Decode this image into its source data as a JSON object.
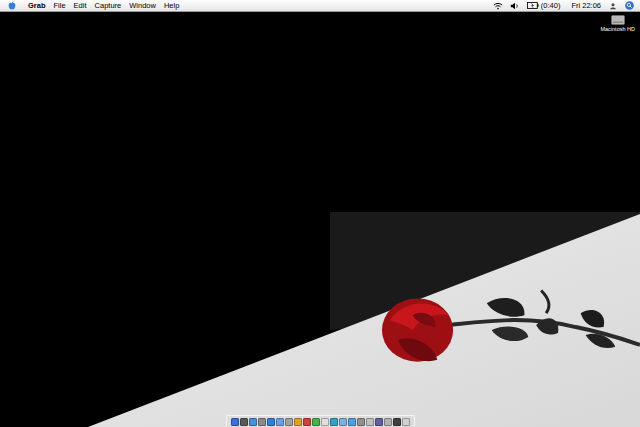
{
  "menu_bar": {
    "app_name": "Grab",
    "menus": [
      "File",
      "Edit",
      "Capture",
      "Window",
      "Help"
    ],
    "battery": "(0:40)",
    "clock": "Fri 22:06"
  },
  "desktop_icons": [
    {
      "label": "Macintosh HD"
    }
  ],
  "dock": {
    "items": [
      {
        "color": "#3b6fd8"
      },
      {
        "color": "#5a5a5a"
      },
      {
        "color": "#4a90d9"
      },
      {
        "color": "#8a8a8a"
      },
      {
        "color": "#2f7fd0"
      },
      {
        "color": "#6aa0e0"
      },
      {
        "color": "#a0a0a0"
      },
      {
        "color": "#e0a030"
      },
      {
        "color": "#d04040"
      },
      {
        "color": "#4ab04a"
      },
      {
        "color": "#e0e0e0"
      },
      {
        "color": "#3aa0c0"
      },
      {
        "color": "#7fb0e0"
      },
      {
        "color": "#50a0e0"
      },
      {
        "color": "#909090"
      },
      {
        "color": "#c0c0c0"
      },
      {
        "color": "#6060a0"
      },
      {
        "color": "#b0b0b0"
      },
      {
        "color": "#404040"
      },
      {
        "color": "#d0d0d0"
      }
    ]
  }
}
